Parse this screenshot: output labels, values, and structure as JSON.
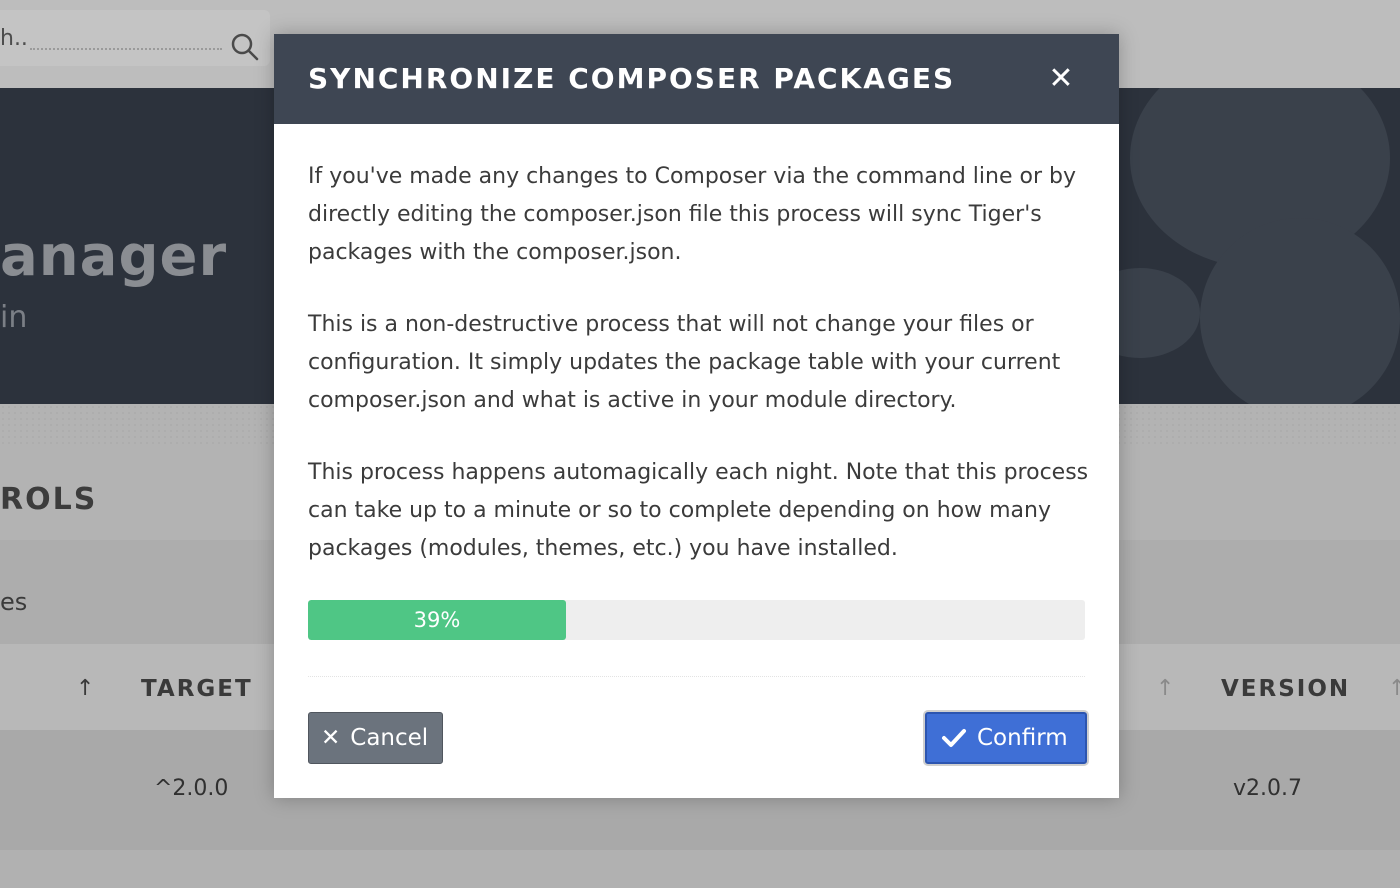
{
  "background": {
    "search_placeholder": "h..",
    "hero_title": "anager",
    "hero_subtitle": "in",
    "section_title": "ROLS",
    "subtab_label": "es",
    "table_headers": {
      "target": "TARGET",
      "version": "VERSION"
    },
    "row": {
      "target": "^2.0.0",
      "version": "v2.0.7"
    }
  },
  "modal": {
    "title": "SYNCHRONIZE COMPOSER PACKAGES",
    "paragraphs": [
      "If you've made any changes to Composer via the command line or by directly editing the composer.json file this process will sync Tiger's packages with the composer.json.",
      "This is a non-destructive process that will not change your files or configuration. It simply updates the package table with your current composer.json and what is active in your module directory.",
      "This process happens automagically each night. Note that this process can take up to a minute or so to complete depending on how many packages (modules, themes, etc.) you have installed."
    ],
    "progress_percent": 39,
    "progress_label": "39%",
    "cancel_label": "Cancel",
    "confirm_label": "Confirm"
  },
  "icons": {
    "search": "search-icon",
    "close": "close-icon",
    "cancel": "x-icon",
    "confirm": "checkmark-icon",
    "sort": "sort-arrow-icon"
  },
  "colors": {
    "header": "#3e4653",
    "progress": "#4fc685",
    "confirm": "#3f6fd6",
    "cancel": "#6b737d"
  }
}
